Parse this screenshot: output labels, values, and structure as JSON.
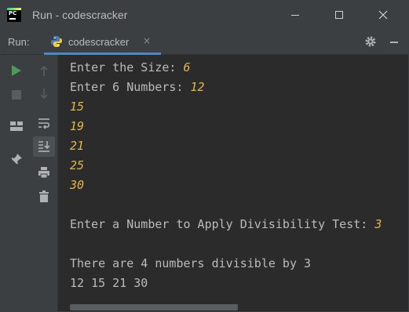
{
  "window": {
    "title": "Run - codescracker",
    "app_icon_text": "PC"
  },
  "run_panel": {
    "label": "Run:",
    "tab_label": "codescracker",
    "tab_close": "×"
  },
  "console": {
    "lines": [
      {
        "prompt": "Enter the Size: ",
        "input": "6"
      },
      {
        "prompt": "Enter 6 Numbers: ",
        "input": "12"
      },
      {
        "prompt": "",
        "input": "15"
      },
      {
        "prompt": "",
        "input": "19"
      },
      {
        "prompt": "",
        "input": "21"
      },
      {
        "prompt": "",
        "input": "25"
      },
      {
        "prompt": "",
        "input": "30"
      },
      {
        "prompt": "Enter a Number to Apply Divisibility Test: ",
        "input": "3"
      },
      {
        "prompt": "There are 4 numbers divisible by 3",
        "input": ""
      },
      {
        "prompt": "12 15 21 30",
        "input": ""
      }
    ]
  },
  "colors": {
    "user_input": "#e2b647",
    "console_text": "#bbbbbb",
    "run_green": "#499c54",
    "tab_accent": "#4a88c7"
  },
  "icons": {
    "left_gutter": [
      "run-icon",
      "stop-icon",
      "layout-icon",
      "pin-icon"
    ],
    "right_gutter": [
      "arrow-up-icon",
      "arrow-down-icon",
      "soft-wrap-icon",
      "scroll-to-end-icon",
      "print-icon",
      "trash-icon"
    ]
  }
}
